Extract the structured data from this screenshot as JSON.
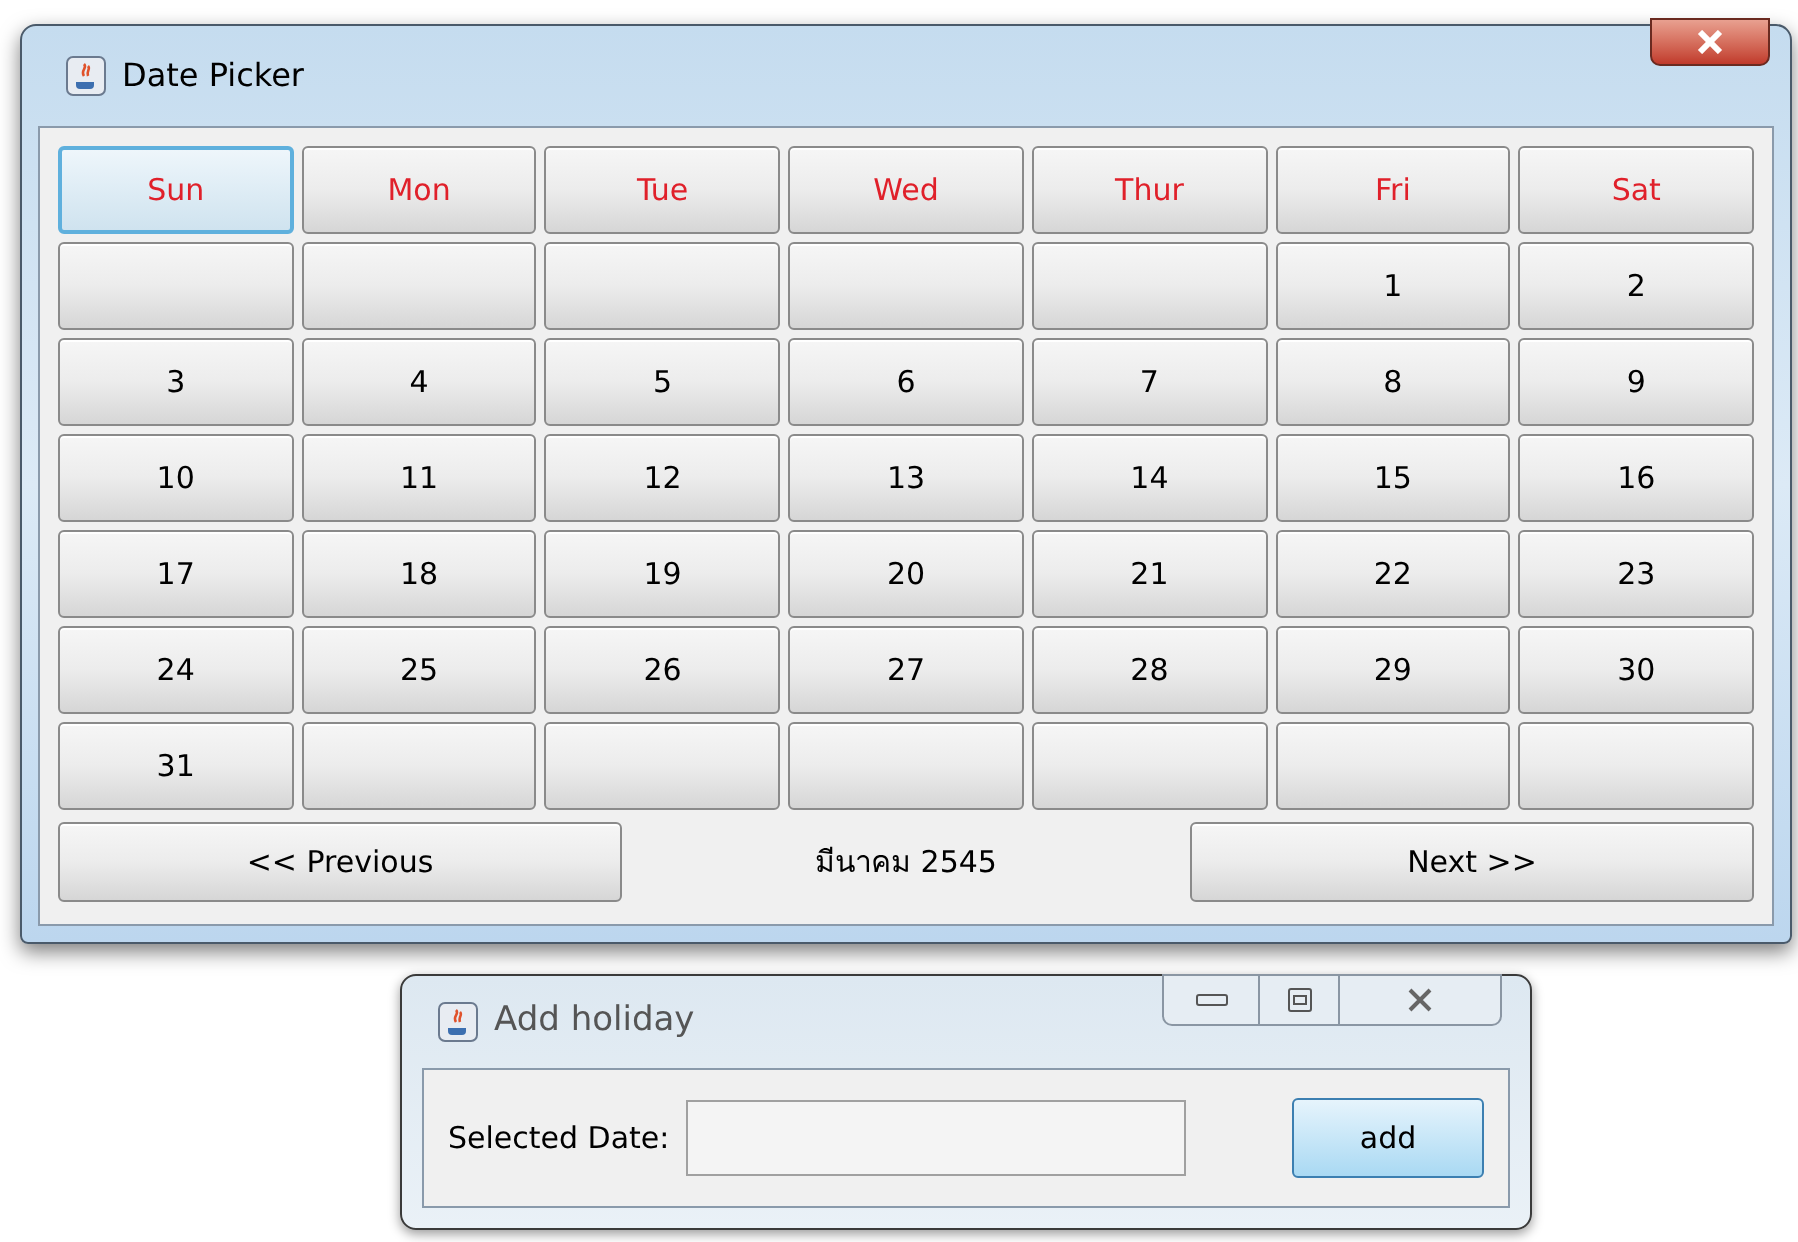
{
  "date_picker": {
    "title": "Date Picker",
    "weekdays": [
      {
        "label": "Sun",
        "selected": true
      },
      {
        "label": "Mon",
        "selected": false
      },
      {
        "label": "Tue",
        "selected": false
      },
      {
        "label": "Wed",
        "selected": false
      },
      {
        "label": "Thur",
        "selected": false
      },
      {
        "label": "Fri",
        "selected": false
      },
      {
        "label": "Sat",
        "selected": false
      }
    ],
    "days": [
      {
        "kind": "blank"
      },
      {
        "kind": "blank"
      },
      {
        "kind": "blank"
      },
      {
        "kind": "blank"
      },
      {
        "kind": "blank"
      },
      {
        "kind": "day",
        "label": "1"
      },
      {
        "kind": "day",
        "label": "2"
      },
      {
        "kind": "day",
        "label": "3"
      },
      {
        "kind": "day",
        "label": "4"
      },
      {
        "kind": "day",
        "label": "5"
      },
      {
        "kind": "day",
        "label": "6"
      },
      {
        "kind": "day",
        "label": "7"
      },
      {
        "kind": "day",
        "label": "8"
      },
      {
        "kind": "day",
        "label": "9"
      },
      {
        "kind": "day",
        "label": "10"
      },
      {
        "kind": "day",
        "label": "11"
      },
      {
        "kind": "day",
        "label": "12"
      },
      {
        "kind": "day",
        "label": "13"
      },
      {
        "kind": "day",
        "label": "14"
      },
      {
        "kind": "day",
        "label": "15"
      },
      {
        "kind": "day",
        "label": "16"
      },
      {
        "kind": "day",
        "label": "17"
      },
      {
        "kind": "day",
        "label": "18"
      },
      {
        "kind": "day",
        "label": "19"
      },
      {
        "kind": "day",
        "label": "20"
      },
      {
        "kind": "day",
        "label": "21"
      },
      {
        "kind": "day",
        "label": "22"
      },
      {
        "kind": "day",
        "label": "23"
      },
      {
        "kind": "day",
        "label": "24"
      },
      {
        "kind": "day",
        "label": "25"
      },
      {
        "kind": "day",
        "label": "26"
      },
      {
        "kind": "day",
        "label": "27"
      },
      {
        "kind": "day",
        "label": "28"
      },
      {
        "kind": "day",
        "label": "29"
      },
      {
        "kind": "day",
        "label": "30"
      },
      {
        "kind": "day",
        "label": "31"
      },
      {
        "kind": "blank"
      },
      {
        "kind": "blank"
      },
      {
        "kind": "blank"
      },
      {
        "kind": "blank"
      },
      {
        "kind": "blank"
      },
      {
        "kind": "blank"
      }
    ],
    "previous_button": "<< Previous",
    "month_label": "มีนาคม 2545",
    "next_button": "Next >>"
  },
  "add_holiday": {
    "title": "Add holiday",
    "field_label": "Selected Date:",
    "add_button": "add"
  }
}
